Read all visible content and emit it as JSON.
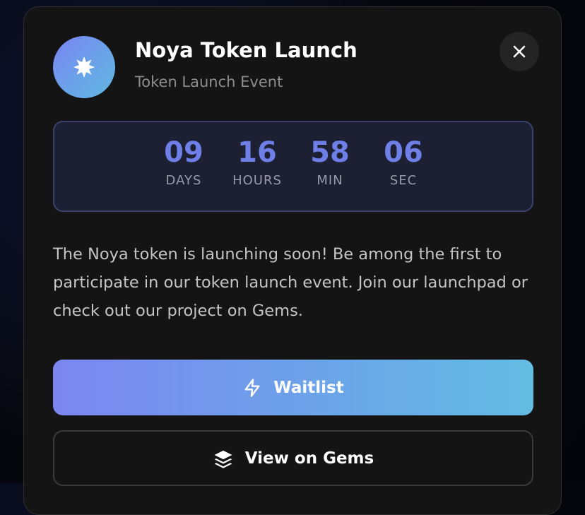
{
  "header": {
    "title": "Noya Token Launch",
    "subtitle": "Token Launch Event",
    "logo_icon": "sparkle-star-icon",
    "close_icon": "close-icon"
  },
  "countdown": [
    {
      "value": "09",
      "label": "DAYS"
    },
    {
      "value": "16",
      "label": "HOURS"
    },
    {
      "value": "58",
      "label": "MIN"
    },
    {
      "value": "06",
      "label": "SEC"
    }
  ],
  "description": "The Noya token is launching soon! Be among the first to participate in our token launch event. Join our launchpad or check out our project on Gems.",
  "actions": {
    "primary": {
      "label": "Waitlist",
      "icon": "lightning-icon"
    },
    "secondary": {
      "label": "View on Gems",
      "icon": "layers-icon"
    }
  },
  "colors": {
    "accent": "#6f7fe8",
    "gradient_start": "#7c86f0",
    "gradient_end": "#63bce2",
    "modal_bg": "#141414",
    "countdown_bg": "#1d1f33"
  }
}
